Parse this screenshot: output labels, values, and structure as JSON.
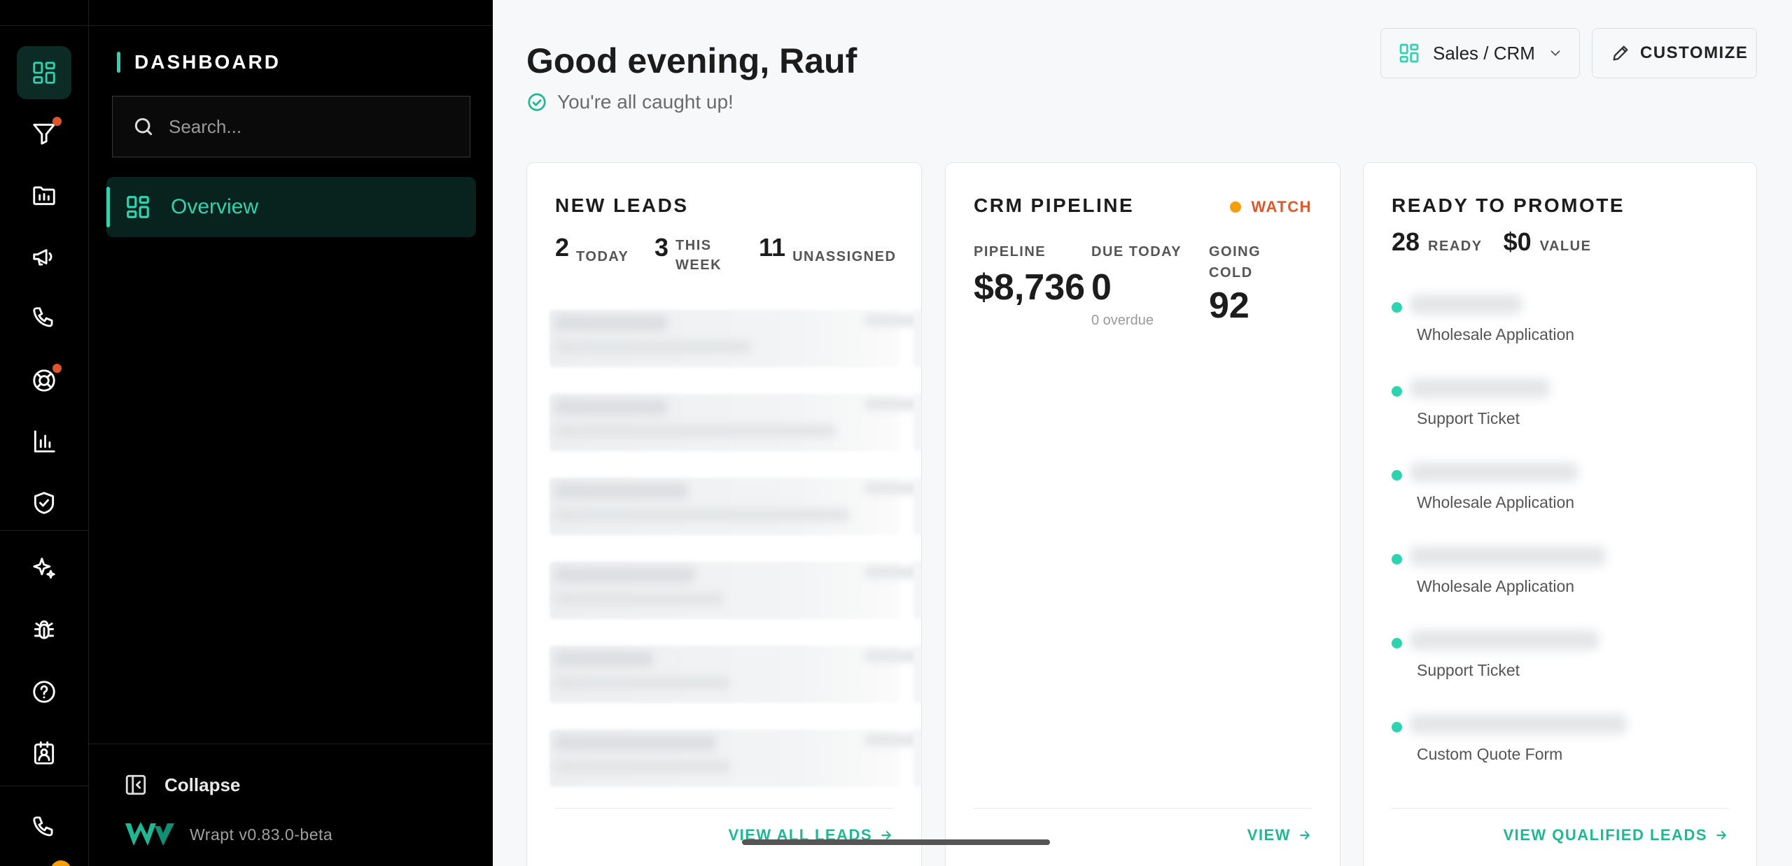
{
  "rail": {
    "items": [
      {
        "name": "dashboard-icon",
        "active": true,
        "badge": false
      },
      {
        "name": "funnel-icon",
        "active": false,
        "badge": true
      },
      {
        "name": "folder-icon",
        "active": false,
        "badge": false
      },
      {
        "name": "megaphone-icon",
        "active": false,
        "badge": false
      },
      {
        "name": "phone-icon",
        "active": false,
        "badge": false
      },
      {
        "name": "lifebuoy-icon",
        "active": false,
        "badge": true
      },
      {
        "name": "bar-chart-icon",
        "active": false,
        "badge": false
      },
      {
        "name": "shield-check-icon",
        "active": false,
        "badge": false
      },
      {
        "name": "sparkles-icon",
        "active": false,
        "badge": false
      },
      {
        "name": "bug-icon",
        "active": false,
        "badge": false
      },
      {
        "name": "help-icon",
        "active": false,
        "badge": false
      },
      {
        "name": "contact-badge-icon",
        "active": false,
        "badge": false
      },
      {
        "name": "phone-icon",
        "active": false,
        "badge": false
      }
    ],
    "badge_color": "#e0562b"
  },
  "panel": {
    "title": "DASHBOARD",
    "search_placeholder": "Search...",
    "nav": [
      {
        "label": "Overview",
        "active": true
      }
    ],
    "collapse_label": "Collapse",
    "version": "Wrapt v0.83.0-beta"
  },
  "header": {
    "greeting": "Good evening, Rauf",
    "status": "You're all caught up!",
    "workspace_select": "Sales / CRM",
    "customize_label": "CUSTOMIZE"
  },
  "cards": {
    "new_leads": {
      "title": "NEW LEADS",
      "stats": [
        {
          "value": "2",
          "label": "TODAY"
        },
        {
          "value": "3",
          "label_line1": "THIS",
          "label_line2": "WEEK"
        },
        {
          "value": "11",
          "label": "UNASSIGNED"
        }
      ],
      "link": "VIEW ALL LEADS"
    },
    "crm_pipeline": {
      "title": "CRM PIPELINE",
      "badge": "WATCH",
      "pipeline_label": "PIPELINE",
      "pipeline_value": "$8,736",
      "due_label": "DUE TODAY",
      "due_value": "0",
      "overdue": "0 overdue",
      "cold_label_line1": "GOING",
      "cold_label_line2": "COLD",
      "cold_value": "92",
      "link": "VIEW"
    },
    "ready_to_promote": {
      "title": "READY TO PROMOTE",
      "ready_value": "28",
      "ready_label": "READY",
      "value_value": "$0",
      "value_label": "VALUE",
      "items": [
        {
          "type": "Wholesale Application"
        },
        {
          "type": "Support Ticket"
        },
        {
          "type": "Wholesale Application"
        },
        {
          "type": "Wholesale Application"
        },
        {
          "type": "Support Ticket"
        },
        {
          "type": "Custom Quote Form"
        }
      ],
      "link": "VIEW QUALIFIED LEADS"
    }
  },
  "colors": {
    "accent": "#2ed3b0",
    "link": "#1fb894",
    "watch": "#e0562b",
    "watch_dot": "#f59e0b"
  }
}
